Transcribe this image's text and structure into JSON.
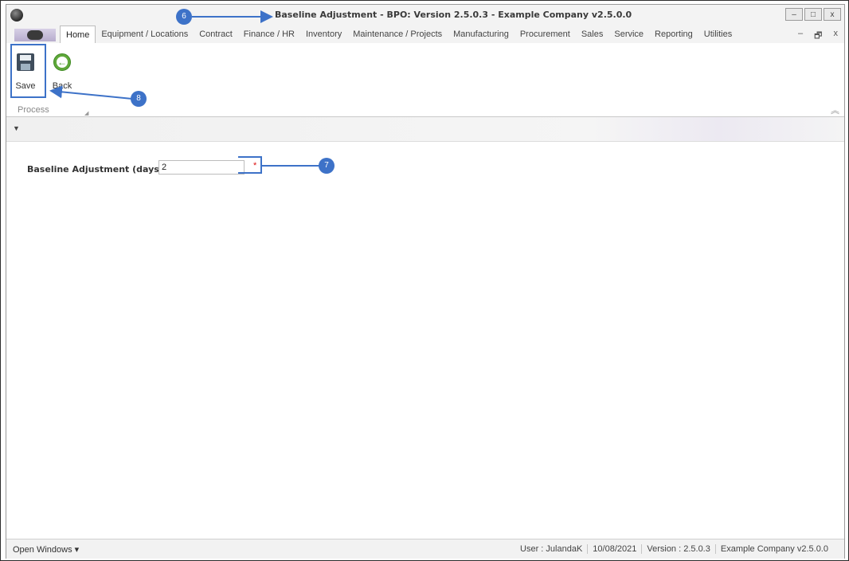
{
  "window": {
    "title": "Baseline Adjustment - BPO: Version 2.5.0.3 - Example Company v2.5.0.0",
    "controls": [
      "–",
      "□",
      "x"
    ]
  },
  "menu": {
    "tabs": [
      "Home",
      "Equipment / Locations",
      "Contract",
      "Finance / HR",
      "Inventory",
      "Maintenance / Projects",
      "Manufacturing",
      "Procurement",
      "Sales",
      "Service",
      "Reporting",
      "Utilities"
    ],
    "active": "Home",
    "mdi_controls": [
      "–",
      "🗗",
      "x"
    ]
  },
  "ribbon": {
    "save_label": "Save",
    "back_label": "Back",
    "group_label": "Process",
    "back_arrow": "←"
  },
  "form": {
    "field_label": "Baseline Adjustment (days)",
    "field_value": "2",
    "required_marker": "*"
  },
  "statusbar": {
    "open_windows": "Open Windows ▾",
    "user": "User : JulandaK",
    "date": "10/08/2021",
    "version": "Version : 2.5.0.3",
    "company": "Example Company v2.5.0.0"
  },
  "annotations": {
    "callout_6": "6",
    "callout_7": "7",
    "callout_8": "8"
  },
  "colors": {
    "annotation": "#3d72c8",
    "required": "#dd1111",
    "back_icon": "#5fa83a"
  }
}
